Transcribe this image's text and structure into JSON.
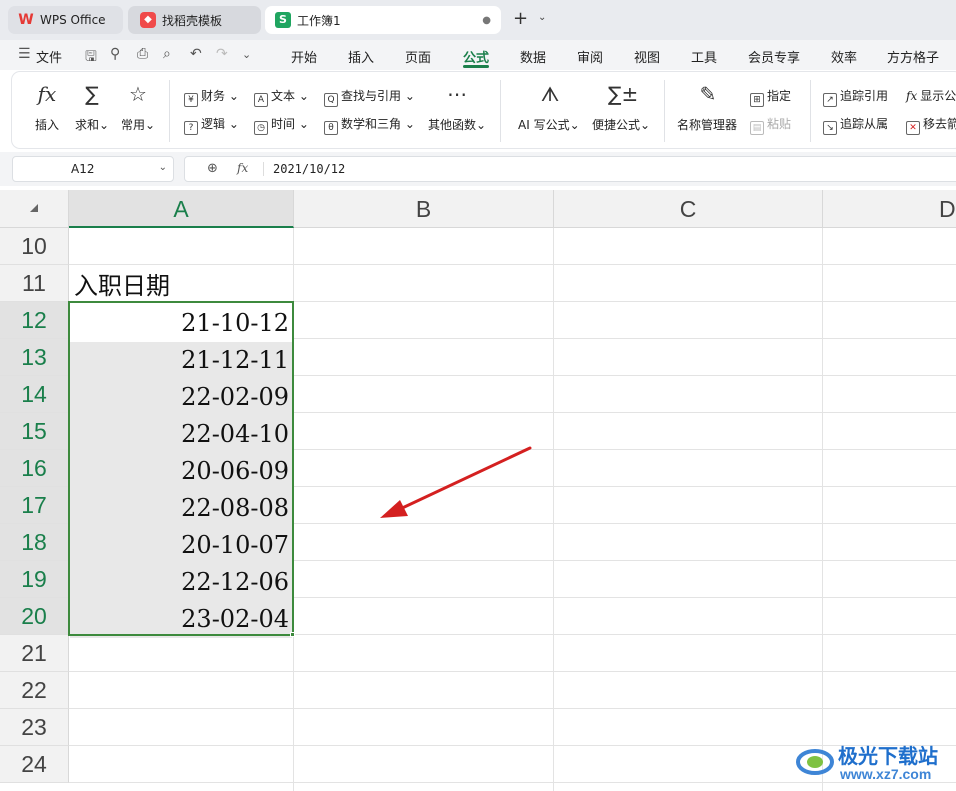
{
  "tabs": [
    {
      "label": "WPS Office",
      "icon": "wps-logo-icon"
    },
    {
      "label": "找稻壳模板",
      "icon": "docer-icon"
    },
    {
      "label": "工作簿1",
      "icon": "spreadsheet-s-icon",
      "unsaved": "●"
    }
  ],
  "newtab": {
    "plus": "+",
    "chevron": "⌄"
  },
  "menu": {
    "file": "文件",
    "items": [
      "开始",
      "插入",
      "页面",
      "公式",
      "数据",
      "审阅",
      "视图",
      "工具",
      "会员专享",
      "效率",
      "方方格子"
    ],
    "active": "公式"
  },
  "ribbon": {
    "insert": "插入",
    "sum": "求和",
    "common": "常用",
    "finance": "财务",
    "logic": "逻辑",
    "text": "文本",
    "time": "时间",
    "lookup": "查找与引用",
    "math": "数学和三角",
    "other": "其他函数",
    "ai": "AI 写公式",
    "quick": "便捷公式",
    "name_mgr": "名称管理器",
    "specify": "指定",
    "paste": "粘贴",
    "trace_prec": "追踪引用",
    "trace_dep": "追踪从属",
    "show_formula": "显示公",
    "remove_arrows": "移去箭"
  },
  "formula_bar": {
    "cell_ref": "A12",
    "fx": "fx",
    "value": "2021/10/12"
  },
  "columns": [
    "A",
    "B",
    "C",
    "D"
  ],
  "rows": [
    "10",
    "11",
    "12",
    "13",
    "14",
    "15",
    "16",
    "17",
    "18",
    "19",
    "20",
    "21",
    "22",
    "23",
    "24"
  ],
  "header_cell": "入职日期",
  "dates": [
    "21-10-12",
    "21-12-11",
    "22-02-09",
    "22-04-10",
    "20-06-09",
    "22-08-08",
    "20-10-07",
    "22-12-06",
    "23-02-04"
  ],
  "colors": {
    "accent": "#1a7f4b",
    "selection_border": "#3d8a3d",
    "arrow": "#d42020"
  },
  "watermark": {
    "name": "极光下载站",
    "url": "www.xz7.com"
  }
}
